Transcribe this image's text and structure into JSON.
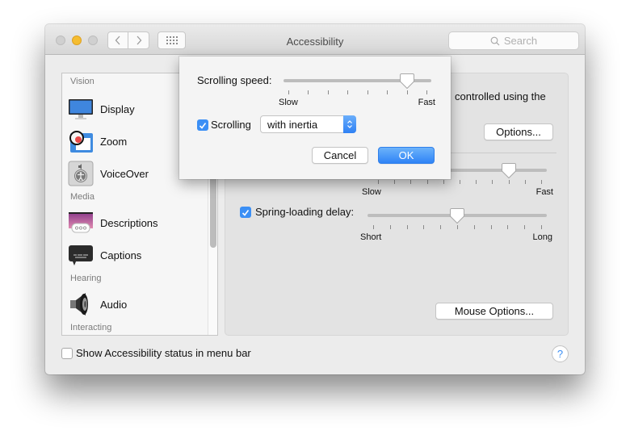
{
  "window": {
    "title": "Accessibility",
    "search_placeholder": "Search"
  },
  "sidebar": {
    "sections": [
      {
        "header": "Vision",
        "items": [
          {
            "label": "Display",
            "icon": "display-icon"
          },
          {
            "label": "Zoom",
            "icon": "zoom-icon"
          },
          {
            "label": "VoiceOver",
            "icon": "voiceover-icon"
          }
        ]
      },
      {
        "header": "Media",
        "items": [
          {
            "label": "Descriptions",
            "icon": "descriptions-icon"
          },
          {
            "label": "Captions",
            "icon": "captions-icon"
          }
        ]
      },
      {
        "header": "Hearing",
        "items": [
          {
            "label": "Audio",
            "icon": "audio-icon"
          }
        ]
      },
      {
        "header": "Interacting",
        "items": []
      }
    ]
  },
  "panel": {
    "partial_text": "controlled using the",
    "options_button": "Options...",
    "double_click_slider": {
      "low_label": "Slow",
      "high_label": "Fast",
      "ticks": 11,
      "value_index": 8
    },
    "spring_loading": {
      "label": "Spring-loading delay:",
      "checked": true,
      "low_label": "Short",
      "high_label": "Long",
      "ticks": 11,
      "value_index": 5
    },
    "mouse_options_button": "Mouse Options..."
  },
  "footer": {
    "status_checkbox_label": "Show Accessibility status in menu bar",
    "status_checked": false,
    "help": "?"
  },
  "sheet": {
    "speed_label": "Scrolling speed:",
    "speed_slider": {
      "low_label": "Slow",
      "high_label": "Fast",
      "ticks": 8,
      "value_index": 6
    },
    "scrolling_label": "Scrolling",
    "scrolling_checked": true,
    "scrolling_mode": "with inertia",
    "cancel_label": "Cancel",
    "ok_label": "OK"
  },
  "colors": {
    "accent": "#3b8ff5",
    "traffic_minimize": "#f5bd31"
  }
}
